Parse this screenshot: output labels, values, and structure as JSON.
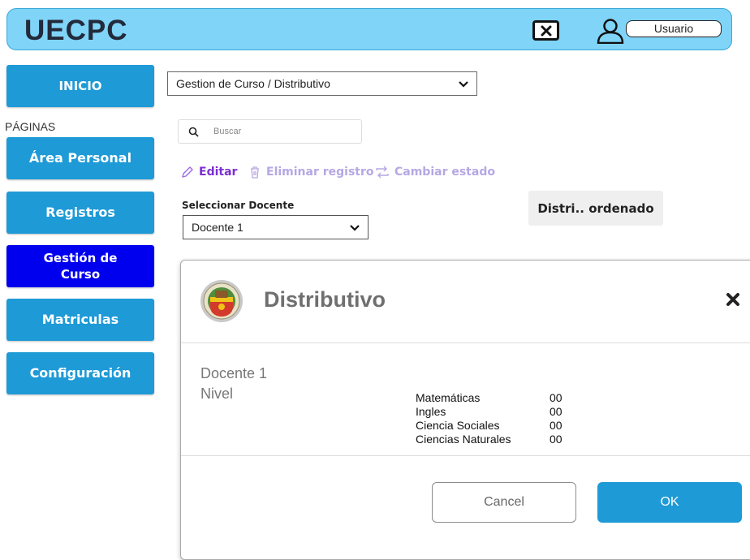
{
  "header": {
    "title": "UECPC",
    "user_label": "Usuario"
  },
  "sidebar": {
    "section_label": "PÁGINAS",
    "items": [
      {
        "label": "INICIO"
      },
      {
        "label": "Área Personal"
      },
      {
        "label": "Registros"
      },
      {
        "label": "Gestión de Curso"
      },
      {
        "label": "Matriculas"
      },
      {
        "label": "Configuración"
      }
    ],
    "active_index": 3
  },
  "main": {
    "breadcrumb": "Gestion de Curso / Distributivo",
    "search_placeholder": "Buscar",
    "toolbar": {
      "edit": "Editar",
      "delete": "Eliminar registro",
      "toggle": "Cambiar estado"
    },
    "docente_label": "Seleccionar Docente",
    "docente_selected": "Docente 1",
    "distri_button": "Distri.. ordenado"
  },
  "modal": {
    "title": "Distributivo",
    "docente": "Docente 1",
    "nivel": "Nivel",
    "subjects": [
      {
        "name": "Matemáticas",
        "value": "00"
      },
      {
        "name": "Ingles",
        "value": "00"
      },
      {
        "name": "Ciencia Sociales",
        "value": "00"
      },
      {
        "name": "Ciencias Naturales",
        "value": "00"
      }
    ],
    "cancel": "Cancel",
    "ok": "OK"
  },
  "colors": {
    "header_bg": "#7fd4f8",
    "primary": "#1e9ad6",
    "active": "#0000ee",
    "toolbar_edit": "#7b2fd0",
    "toolbar_muted": "#b7a7e3"
  },
  "icons": [
    "close-icon",
    "user-icon",
    "chevron-down-icon",
    "search-icon",
    "pencil-icon",
    "trash-icon",
    "repeat-icon",
    "school-logo",
    "close-icon"
  ]
}
